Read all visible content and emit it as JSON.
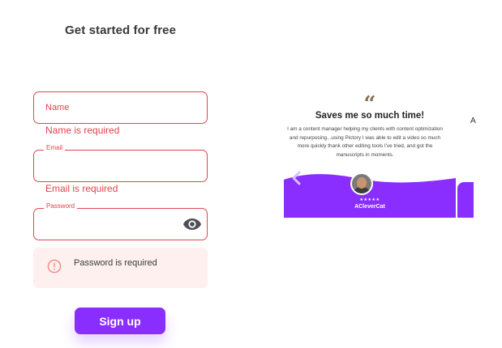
{
  "page": {
    "heading": "Get started for free"
  },
  "form": {
    "name": {
      "placeholder": "Name",
      "value": "",
      "error": "Name is required"
    },
    "email": {
      "label": "Email",
      "value": "",
      "error": "Email is required"
    },
    "password": {
      "label": "Password",
      "value": "",
      "toggle_icon": "eye-icon"
    },
    "alert": {
      "icon": "alert-circle-icon",
      "text": "Password is required"
    },
    "submit_label": "Sign up"
  },
  "testimonial": {
    "quote_mark": "“",
    "title": "Saves me so much time!",
    "body": "I am a content manager helping my clients with content optimization and repurposing...using Pictory I was able to edit a video so much more quickly thank other editing tools I've tried, and got the manuscripts in moments.",
    "stars": "★★★★★",
    "author": "ACleverCat",
    "next_peek": "A"
  },
  "colors": {
    "accent": "#8a2eff",
    "error": "#e0454e",
    "alert_bg": "#fdf0ef"
  }
}
